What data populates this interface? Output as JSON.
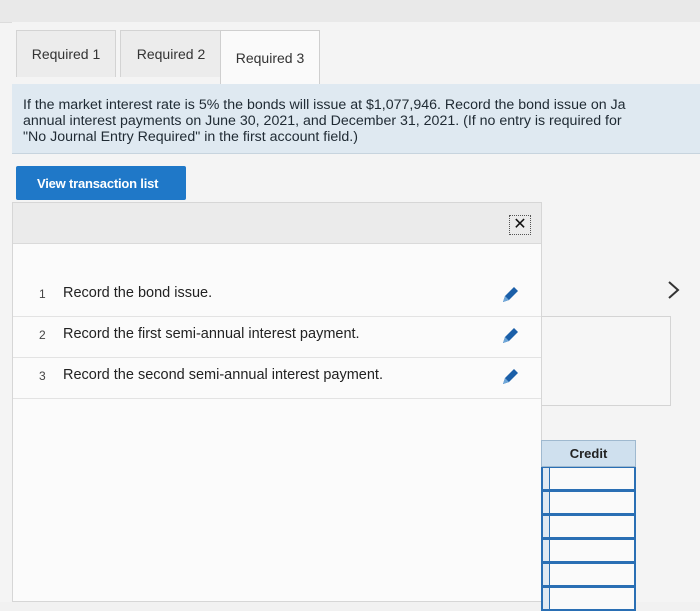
{
  "tabs": [
    {
      "label": "Required 1",
      "active": false
    },
    {
      "label": "Required 2",
      "active": false
    },
    {
      "label": "Required 3",
      "active": true
    }
  ],
  "instructions": {
    "line1": "If the market interest rate is 5% the bonds will issue at $1,077,946. Record the bond issue on Ja",
    "line2": "annual interest payments on June 30, 2021, and December 31, 2021. (If no entry is required for",
    "line3": "\"No Journal Entry Required\" in the first account field.)"
  },
  "view_button": {
    "label": "View transaction list"
  },
  "transactions": [
    {
      "num": "1",
      "text": "Record the bond issue."
    },
    {
      "num": "2",
      "text": "Record the first semi-annual interest payment."
    },
    {
      "num": "3",
      "text": "Record the second semi-annual interest payment."
    }
  ],
  "journal": {
    "credit_label": "Credit"
  },
  "colors": {
    "accent": "#1f78c8",
    "instruction_bg": "#dfe9f1",
    "pencil": "#1b5fa8"
  },
  "icons": {
    "close": "close-icon",
    "edit": "pencil-icon",
    "next": "chevron-right-icon"
  }
}
